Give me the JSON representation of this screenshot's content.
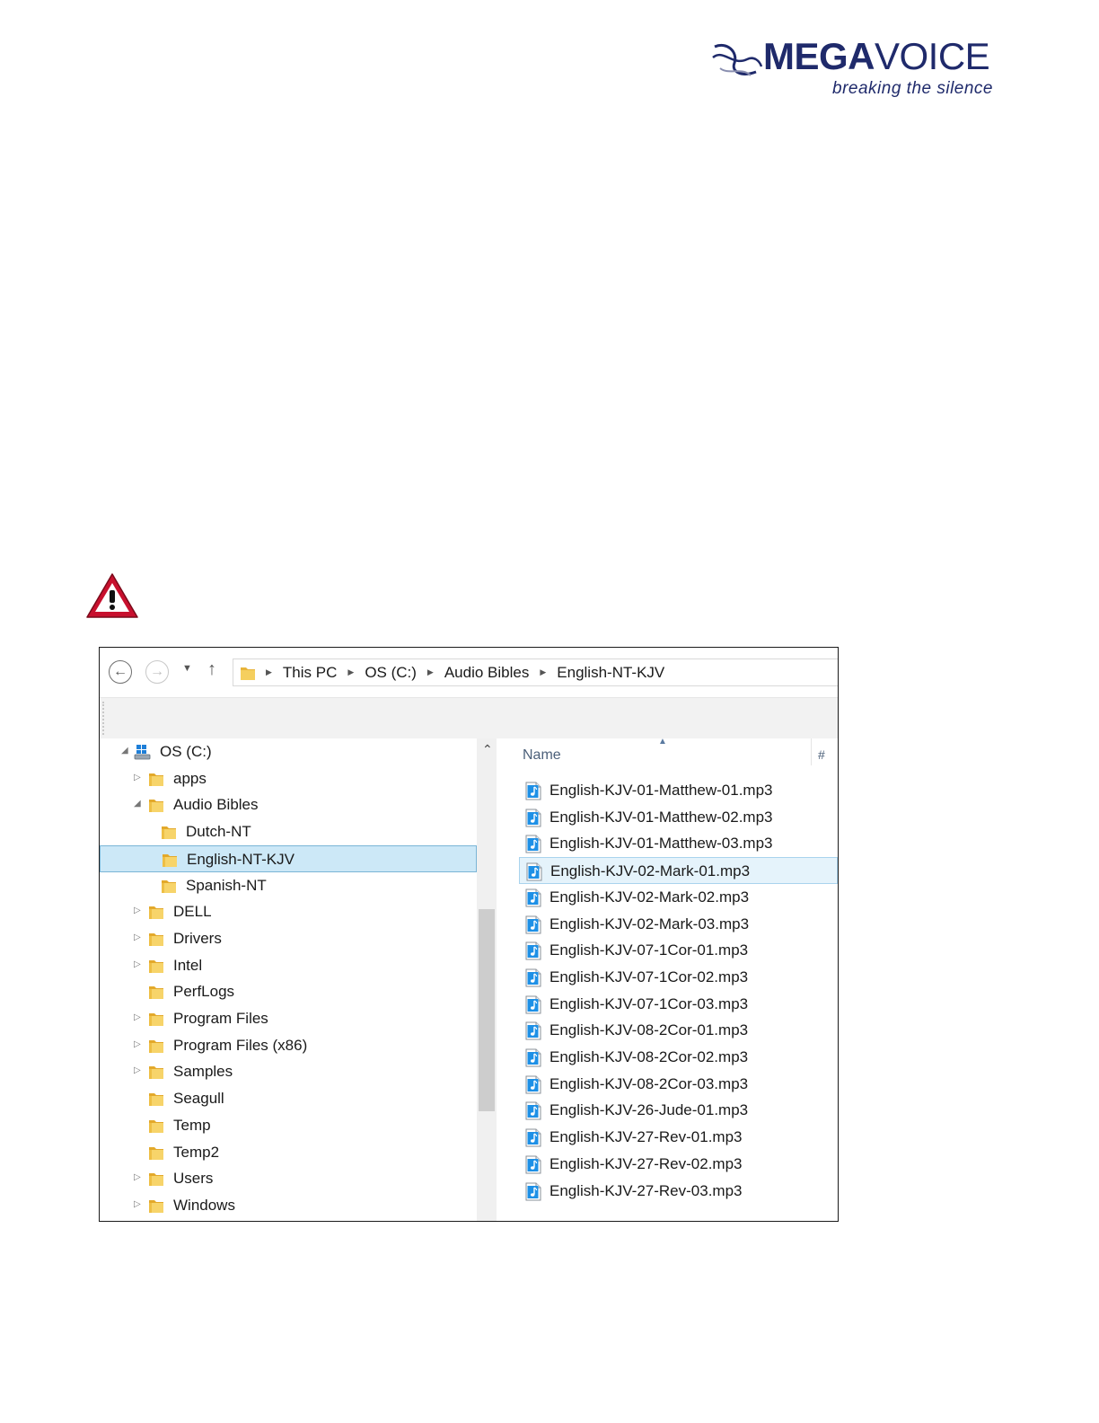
{
  "logo": {
    "word_bold": "MEGA",
    "word_regular": "VOICE",
    "tagline": "breaking the silence"
  },
  "colors": {
    "brand": "#1f2a6b",
    "selection": "#cce8f7",
    "warning": "#c8102e"
  },
  "explorer": {
    "breadcrumb": [
      "This PC",
      "OS (C:)",
      "Audio Bibles",
      "English-NT-KJV"
    ],
    "tree": {
      "root_label": "OS (C:)",
      "items": [
        {
          "label": "apps",
          "expander": "collapsed"
        },
        {
          "label": "Audio Bibles",
          "expander": "expanded"
        },
        {
          "label": "Dutch-NT",
          "expander": "none"
        },
        {
          "label": "English-NT-KJV",
          "expander": "none",
          "selected": true
        },
        {
          "label": "Spanish-NT",
          "expander": "none"
        },
        {
          "label": "DELL",
          "expander": "collapsed"
        },
        {
          "label": "Drivers",
          "expander": "collapsed"
        },
        {
          "label": "Intel",
          "expander": "collapsed"
        },
        {
          "label": "PerfLogs",
          "expander": "none"
        },
        {
          "label": "Program Files",
          "expander": "collapsed"
        },
        {
          "label": "Program Files (x86)",
          "expander": "collapsed"
        },
        {
          "label": "Samples",
          "expander": "collapsed"
        },
        {
          "label": "Seagull",
          "expander": "none"
        },
        {
          "label": "Temp",
          "expander": "none"
        },
        {
          "label": "Temp2",
          "expander": "none"
        },
        {
          "label": "Users",
          "expander": "collapsed"
        },
        {
          "label": "Windows",
          "expander": "collapsed"
        }
      ]
    },
    "file_list": {
      "columns": {
        "name": "Name",
        "number": "#"
      },
      "files": [
        "English-KJV-01-Matthew-01.mp3",
        "English-KJV-01-Matthew-02.mp3",
        "English-KJV-01-Matthew-03.mp3",
        "English-KJV-02-Mark-01.mp3",
        "English-KJV-02-Mark-02.mp3",
        "English-KJV-02-Mark-03.mp3",
        "English-KJV-07-1Cor-01.mp3",
        "English-KJV-07-1Cor-02.mp3",
        "English-KJV-07-1Cor-03.mp3",
        "English-KJV-08-2Cor-01.mp3",
        "English-KJV-08-2Cor-02.mp3",
        "English-KJV-08-2Cor-03.mp3",
        "English-KJV-26-Jude-01.mp3",
        "English-KJV-27-Rev-01.mp3",
        "English-KJV-27-Rev-02.mp3",
        "English-KJV-27-Rev-03.mp3"
      ],
      "selected_file": "English-KJV-02-Mark-01.mp3"
    }
  }
}
